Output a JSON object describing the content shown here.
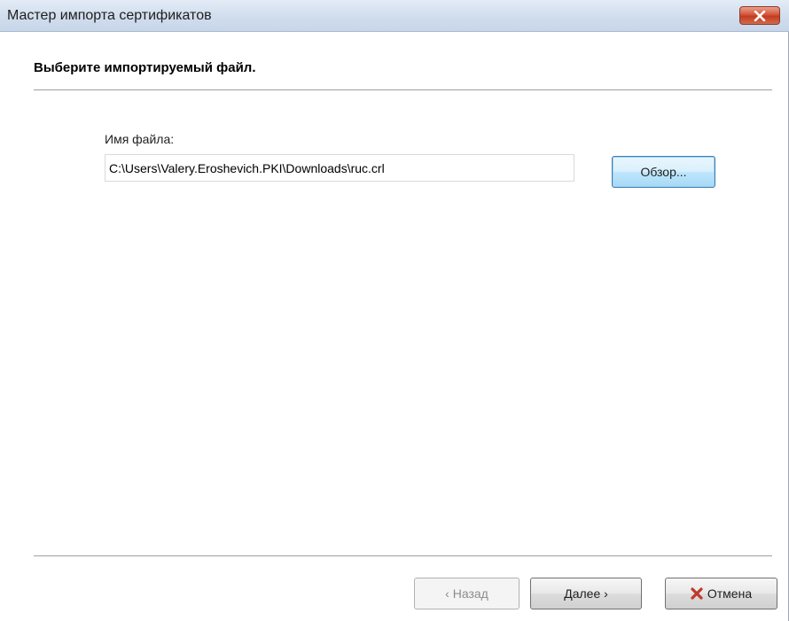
{
  "window": {
    "title": "Мастер импорта сертификатов",
    "close_icon": "close-icon"
  },
  "page": {
    "heading": "Выберите импортируемый файл."
  },
  "file": {
    "label": "Имя файла:",
    "value": "C:\\Users\\Valery.Eroshevich.PKI\\Downloads\\ruc.crl",
    "browse_label": "Обзор..."
  },
  "footer": {
    "back_label": "‹ Назад",
    "back_enabled": false,
    "next_label": "Далее ›",
    "cancel_label": "Отмена",
    "cancel_icon": "red-x-icon"
  },
  "colors": {
    "close_button": "#c7402a",
    "cancel_x": "#c0392b",
    "focus_button_border": "#3c7fb1"
  }
}
